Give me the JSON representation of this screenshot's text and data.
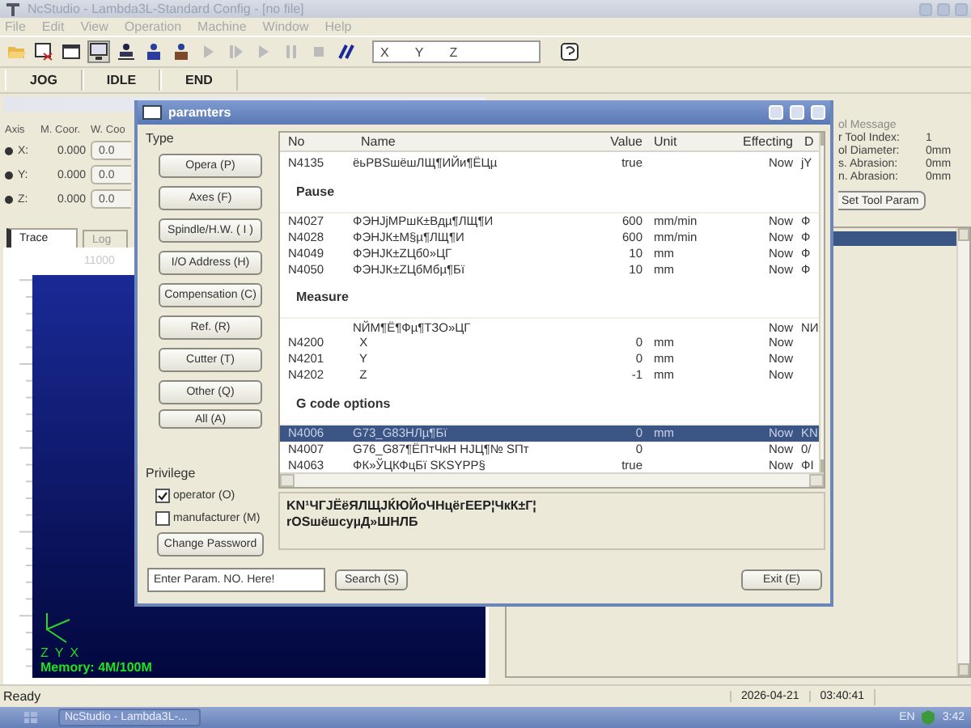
{
  "window": {
    "title": "NcStudio - Lambda3L-Standard Config - [no file]"
  },
  "menu": [
    "File",
    "Edit",
    "View",
    "Operation",
    "Machine",
    "Window",
    "Help"
  ],
  "toolbar": {
    "coordinate_labels": [
      "X",
      "Y",
      "Z"
    ]
  },
  "state_bar": [
    "JOG",
    "IDLE",
    "END"
  ],
  "axis_panel": {
    "columns": [
      "Axis",
      "M. Coor.",
      "W. Coo"
    ],
    "rows": [
      {
        "label": "X:",
        "machine": "0.000",
        "work": "0.0"
      },
      {
        "label": "Y:",
        "machine": "0.000",
        "work": "0.0"
      },
      {
        "label": "Z:",
        "machine": "0.000",
        "work": "0.0"
      }
    ]
  },
  "view_tabs": [
    {
      "label": "Trace",
      "selected": true
    },
    {
      "label": "Log",
      "selected": false
    }
  ],
  "canvas": {
    "ruler_label": "11000",
    "axis_labels": [
      "Z",
      "Y",
      "X"
    ],
    "memory": "Memory: 4M/100M"
  },
  "tool_message": {
    "title": "ol Message",
    "fields": [
      {
        "label": "r Tool Index:",
        "value": "1"
      },
      {
        "label": "ol Diameter:",
        "value": "0mm"
      },
      {
        "label": "s. Abrasion:",
        "value": "0mm"
      },
      {
        "label": "n. Abrasion:",
        "value": "0mm"
      }
    ],
    "button": "Set Tool Param"
  },
  "dialog": {
    "title": "paramters",
    "type_label": "Type",
    "type_buttons": [
      "Opera (P)",
      "Axes (F)",
      "Spindle/H.W. ( I )",
      "I/O Address (H)",
      "Compensation (C)",
      "Ref. (R)",
      "Cutter (T)",
      "Other (Q)",
      "All (A)"
    ],
    "privilege_label": "Privilege",
    "privileges": [
      {
        "label": "operator (O)",
        "checked": true
      },
      {
        "label": "manufacturer (M)",
        "checked": false
      }
    ],
    "change_password": "Change Password",
    "table": {
      "columns": [
        "No",
        "Name",
        "Value",
        "Unit",
        "Effecting",
        "D"
      ],
      "rows": [
        {
          "kind": "param",
          "no": "N4135",
          "name": "ёьРBSшёшЛЩ¶ИЙи¶ЁЦµ",
          "value": "true",
          "unit": "",
          "effecting": "Now",
          "d": "jY",
          "selected": false
        },
        {
          "kind": "section",
          "name": "Pause"
        },
        {
          "kind": "param",
          "no": "N4027",
          "name": "ФЭНJјМРшК±Вдµ¶ЛЩ¶И",
          "value": "600",
          "unit": "mm/min",
          "effecting": "Now",
          "d": "Ф",
          "selected": false
        },
        {
          "kind": "param",
          "no": "N4028",
          "name": "ФЭНJК±М§µ¶ЛЩ¶И",
          "value": "600",
          "unit": "mm/min",
          "effecting": "Now",
          "d": "Ф",
          "selected": false
        },
        {
          "kind": "param",
          "no": "N4049",
          "name": "ФЭНJК±ZЦб0»ЦГ",
          "value": "10",
          "unit": "mm",
          "effecting": "Now",
          "d": "Ф",
          "selected": false
        },
        {
          "kind": "param",
          "no": "N4050",
          "name": "ФЭНJК±ZЦбМбµ¶Бї",
          "value": "10",
          "unit": "mm",
          "effecting": "Now",
          "d": "Ф",
          "selected": false
        },
        {
          "kind": "section",
          "name": "Measure"
        },
        {
          "kind": "param",
          "no": "",
          "name": "NЙМ¶Ё¶Фµ¶ТЗО»ЦГ",
          "value": "",
          "unit": "",
          "effecting": "Now",
          "d": "NИ",
          "selected": false
        },
        {
          "kind": "param",
          "no": "N4200",
          "name": "  X",
          "value": "0",
          "unit": "mm",
          "effecting": "Now",
          "d": "",
          "selected": false
        },
        {
          "kind": "param",
          "no": "N4201",
          "name": "  Y",
          "value": "0",
          "unit": "mm",
          "effecting": "Now",
          "d": "",
          "selected": false
        },
        {
          "kind": "param",
          "no": "N4202",
          "name": "  Z",
          "value": "-1",
          "unit": "mm",
          "effecting": "Now",
          "d": "",
          "selected": false
        },
        {
          "kind": "section",
          "name": "G code options"
        },
        {
          "kind": "param",
          "no": "N4006",
          "name": "G73_G83НЛµ¶Бї",
          "value": "0",
          "unit": "mm",
          "effecting": "Now",
          "d": "KN",
          "selected": true
        },
        {
          "kind": "param",
          "no": "N4007",
          "name": "G76_G87¶ЁПтЧкН НЈЦ¶№ SПт",
          "value": "0",
          "unit": "",
          "effecting": "Now",
          "d": "0/",
          "selected": false
        },
        {
          "kind": "param",
          "no": "N4063",
          "name": "ФК»ЎЦКФцБї SKSYPP§",
          "value": "true",
          "unit": "",
          "effecting": "Now",
          "d": "ФІ",
          "selected": false
        }
      ]
    },
    "description": [
      "KN¹ЧГЈЁёЯЛЩЈЌЮЙоЧНцёгЕЕР¦ЧкК±Г¦",
      "rОSшёшсуµД»ШНЛБ"
    ],
    "search": {
      "placeholder": "Enter Param. NO. Here!",
      "button": "Search (S)"
    },
    "exit": "Exit (E)"
  },
  "status_bar": {
    "text": "Ready",
    "date": "2026-04-21",
    "time": "03:40:41"
  },
  "taskbar": {
    "task": "NcStudio - Lambda3L-...",
    "language": "EN",
    "clock": "3:42"
  }
}
